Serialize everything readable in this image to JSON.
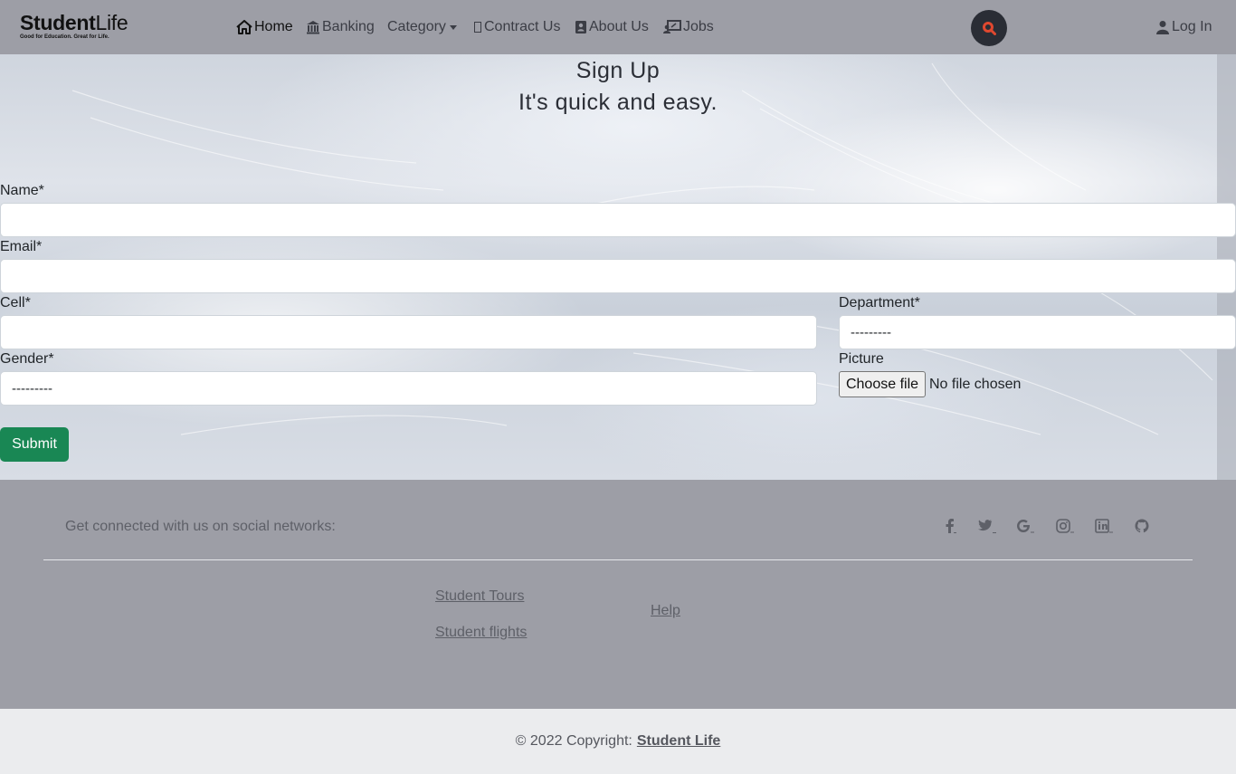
{
  "navbar": {
    "brand_main_bold": "Student",
    "brand_main_light": "Life",
    "brand_tagline": "Good for Education. Great for Life.",
    "items": [
      {
        "label": "Home",
        "icon": "home-icon"
      },
      {
        "label": "Banking",
        "icon": "bank-icon"
      },
      {
        "label": "Category",
        "icon": "caret-down-icon"
      },
      {
        "label": "Contract Us",
        "icon": "missing-glyph-icon"
      },
      {
        "label": "About Us",
        "icon": "contact-card-icon"
      },
      {
        "label": "Jobs",
        "icon": "jobs-icon"
      }
    ],
    "login_label": "Log In",
    "search_icon_color": "#e0482f"
  },
  "signup": {
    "title": "Sign Up",
    "subtitle": "It's quick and easy.",
    "name_label": "Name*",
    "name_value": "",
    "email_label": "Email*",
    "email_value": "",
    "cell_label": "Cell*",
    "cell_value": "",
    "department_label": "Department*",
    "department_selected": "---------",
    "gender_label": "Gender*",
    "gender_selected": "---------",
    "picture_label": "Picture",
    "file_button": "Choose file",
    "file_status": "No file chosen",
    "submit_label": "Submit",
    "submit_color": "#198754"
  },
  "footer": {
    "social_text": "Get connected with us on social networks:",
    "social_icons": [
      "facebook-icon",
      "twitter-icon",
      "google-icon",
      "instagram-icon",
      "linkedin-icon",
      "github-icon"
    ],
    "links_col1": [
      "Student Tours",
      "Student flights"
    ],
    "links_col2": [
      "Help"
    ],
    "copyright_text": "© 2022 Copyright:",
    "copyright_brand": "Student Life"
  }
}
